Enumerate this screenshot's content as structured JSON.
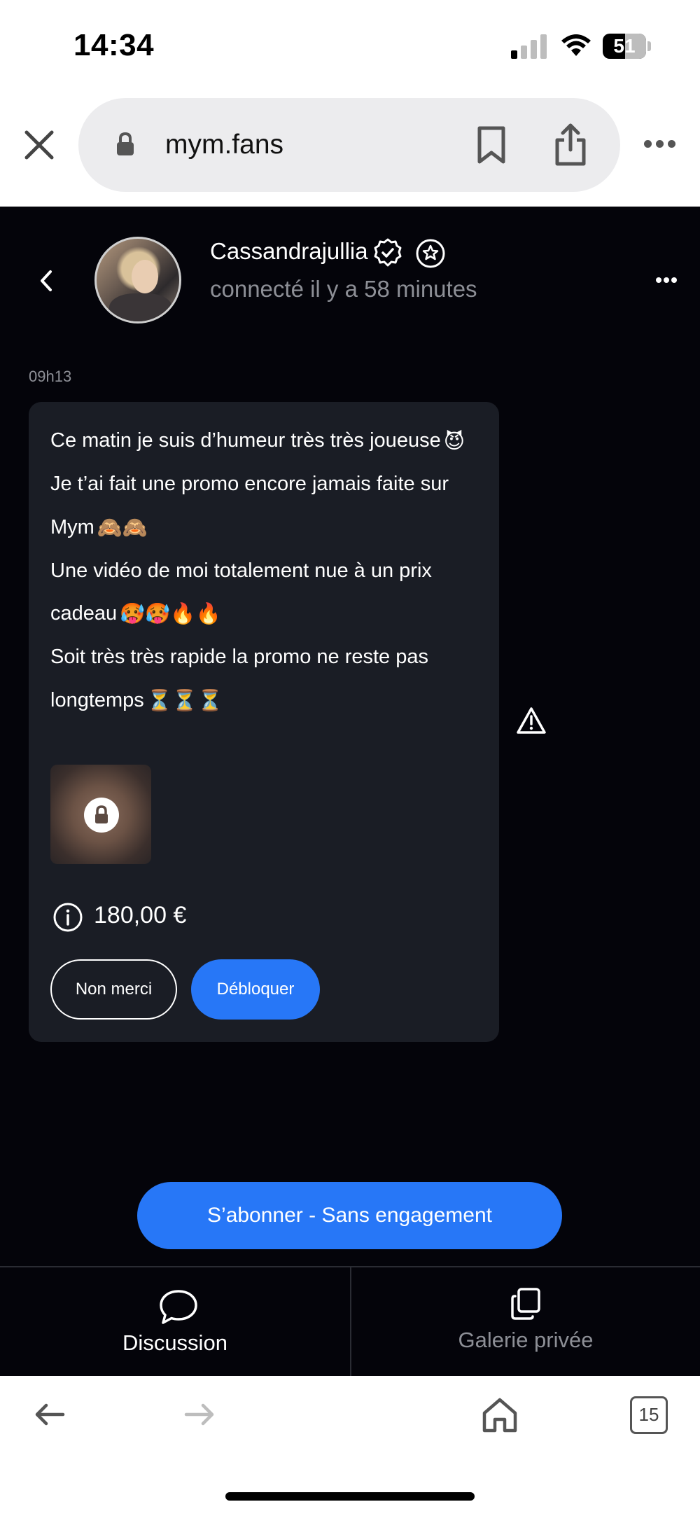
{
  "status_bar": {
    "time": "14:34",
    "battery": "51"
  },
  "browser": {
    "url": "mym.fans",
    "tab_count": "15"
  },
  "conversation": {
    "username": "Cassandrajullia",
    "last_seen": "connecté il y a 58 minutes"
  },
  "message": {
    "time": "09h13",
    "lines": [
      {
        "text": "Ce matin je suis d’humeur très très joueuse",
        "emoji": "😈"
      },
      {
        "text": "Je t’ai fait une promo encore jamais faite sur",
        "emoji": ""
      },
      {
        "text": "Mym",
        "emoji": "🙈🙈"
      },
      {
        "text": "Une vidéo de moi totalement nue à un prix",
        "emoji": ""
      },
      {
        "text": "cadeau",
        "emoji": "🥵🥵🔥🔥"
      },
      {
        "text": "Soit très très rapide la promo ne reste pas",
        "emoji": ""
      },
      {
        "text": "longtemps",
        "emoji": "⏳⏳⏳"
      }
    ],
    "price": "180,00 €",
    "decline_label": "Non merci",
    "unlock_label": "Débloquer"
  },
  "subscribe_label": "S’abonner - Sans engagement",
  "tabs": [
    {
      "label": "Discussion",
      "active": true
    },
    {
      "label": "Galerie privée",
      "active": false
    }
  ],
  "colors": {
    "accent": "#2777f7",
    "background": "#04040a",
    "bubble": "#1a1d25",
    "muted_text": "#8d8f96"
  }
}
